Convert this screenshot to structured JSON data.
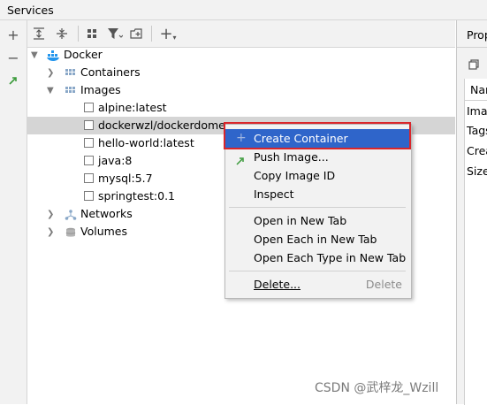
{
  "window": {
    "title": "Services"
  },
  "tree": {
    "root": "Docker",
    "containers": "Containers",
    "images": "Images",
    "image_items": [
      "alpine:latest",
      "dockerwzl/dockerdome:",
      "hello-world:latest",
      "java:8",
      "mysql:5.7",
      "springtest:0.1"
    ],
    "networks": "Networks",
    "volumes": "Volumes"
  },
  "context_menu": {
    "create_container": "Create Container",
    "push_image": "Push Image...",
    "copy_image_id": "Copy Image ID",
    "inspect": "Inspect",
    "open_new_tab": "Open in New Tab",
    "open_each_new_tab": "Open Each in New Tab",
    "open_each_type_new_tab": "Open Each Type in New Tab",
    "delete": "Delete...",
    "delete_shortcut": "Delete"
  },
  "properties": {
    "tab": "Prop",
    "header": "Nan",
    "rows": [
      "Imag",
      "Tags",
      "Crea",
      "Size"
    ]
  },
  "watermark": "CSDN @武梓龙_Wzill"
}
